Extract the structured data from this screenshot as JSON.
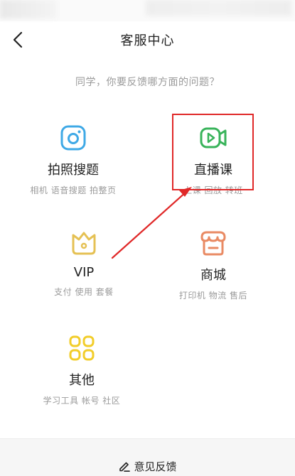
{
  "header": {
    "title": "客服中心"
  },
  "subtitle": "同学，你要反馈哪方面的问题？",
  "categories": [
    {
      "name": "拍照搜题",
      "desc": "相机 语音搜题 拍整页",
      "icon": "camera-icon",
      "color": "#3fa9e6"
    },
    {
      "name": "直播课",
      "desc": "上课 回放 转班",
      "icon": "video-play-icon",
      "color": "#38b35a",
      "highlighted": true
    },
    {
      "name": "VIP",
      "desc": "支付 使用 套餐",
      "icon": "crown-icon",
      "color": "#e5c154"
    },
    {
      "name": "商城",
      "desc": "打印机 物流 售后",
      "icon": "shop-icon",
      "color": "#e98a63"
    },
    {
      "name": "其他",
      "desc": "学习工具 帐号 社区",
      "icon": "grid-icon",
      "color": "#f2cd2a"
    }
  ],
  "footer": {
    "feedback_label": "意见反馈",
    "icon": "edit-icon"
  },
  "annotation_color": "#e02828"
}
